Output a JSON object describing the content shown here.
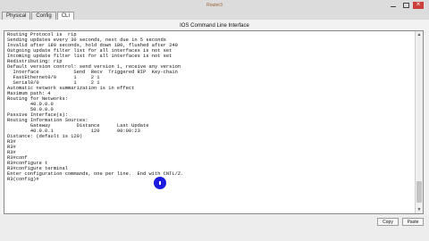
{
  "window": {
    "title": "Router3",
    "tabs": [
      "Physical",
      "Config",
      "CLI"
    ]
  },
  "cli": {
    "title": "IOS Command Line Interface",
    "lines": [
      "Routing Protocol is  rip",
      "Sending updates every 30 seconds, next due in 5 seconds",
      "Invalid after 180 seconds, hold down 180, flushed after 240",
      "Outgoing update filter list for all interfaces is not set",
      "Incoming update filter list for all interfaces is not set",
      "Redistributing: rip",
      "Default version control: send version 1, receive any version",
      "  Interface            Send  Recv  Triggered RIP  Key-chain",
      "  FastEthernet0/0      1     2 1",
      "  Serial0/0            1     2 1",
      "Automatic network summarization is in effect",
      "Maximum path: 4",
      "Routing for Networks:",
      "        40.0.0.0",
      "        50.0.0.0",
      "Passive Interface(s):",
      "Routing Information Sources:",
      "        Gateway         Distance      Last Update",
      "        40.0.0.1             120      00:00:23",
      "Distance: (default is 120)",
      "R3#",
      "R3#",
      "R3#",
      "R3#conf",
      "R3#configure t",
      "R3#configure terminal",
      "Enter configuration commands, one per line.  End with CNTL/Z.",
      "R3(config)#"
    ]
  },
  "buttons": {
    "copy": "Copy",
    "paste": "Paste"
  }
}
